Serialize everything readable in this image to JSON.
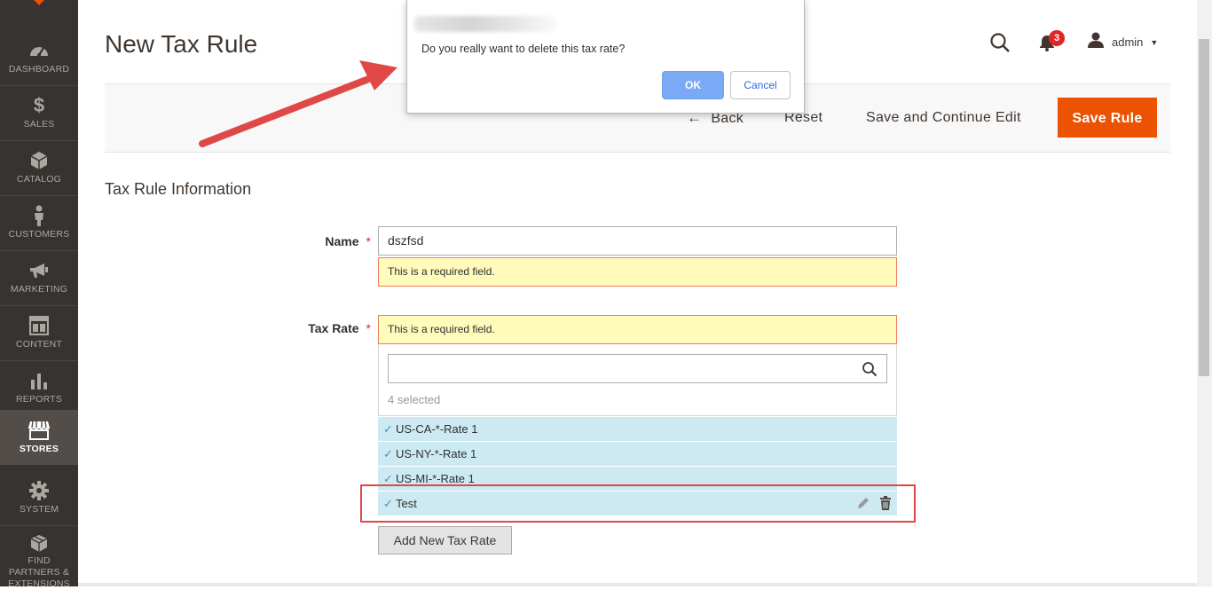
{
  "sidebar": {
    "items": [
      {
        "label": "DASHBOARD",
        "icon": "dashboard-icon",
        "active": false
      },
      {
        "label": "SALES",
        "icon": "dollar-icon",
        "active": false
      },
      {
        "label": "CATALOG",
        "icon": "cube-icon",
        "active": false
      },
      {
        "label": "CUSTOMERS",
        "icon": "person-icon",
        "active": false
      },
      {
        "label": "MARKETING",
        "icon": "megaphone-icon",
        "active": false
      },
      {
        "label": "CONTENT",
        "icon": "layout-icon",
        "active": false
      },
      {
        "label": "REPORTS",
        "icon": "bar-chart-icon",
        "active": false
      },
      {
        "label": "STORES",
        "icon": "storefront-icon",
        "active": true
      },
      {
        "label": "SYSTEM",
        "icon": "gear-icon",
        "active": false
      },
      {
        "label": "FIND PARTNERS & EXTENSIONS",
        "icon": "boxes-icon",
        "active": false
      }
    ]
  },
  "header": {
    "title": "New Tax Rule",
    "notifications_count": "3",
    "user_name": "admin"
  },
  "actions": {
    "back": "Back",
    "reset": "Reset",
    "save_continue": "Save and Continue Edit",
    "save_rule": "Save Rule"
  },
  "form": {
    "section_title": "Tax Rule Information",
    "name_label": "Name",
    "name_value": "dszfsd",
    "name_error": "This is a required field.",
    "tax_rate_label": "Tax Rate",
    "tax_rate_error": "This is a required field.",
    "selected_count": "4 selected",
    "tax_rates": [
      "US-CA-*-Rate 1",
      "US-NY-*-Rate 1",
      "US-MI-*-Rate 1",
      "Test"
    ],
    "add_new_rate": "Add New Tax Rate"
  },
  "dialog": {
    "message": "Do you really want to delete this tax rate?",
    "ok": "OK",
    "cancel": "Cancel"
  },
  "colors": {
    "accent": "#eb5202",
    "sidebar_bg": "#373330",
    "selected_row": "#cdeaf3",
    "error_bg": "#fffbbb",
    "annotation": "#e04848"
  }
}
